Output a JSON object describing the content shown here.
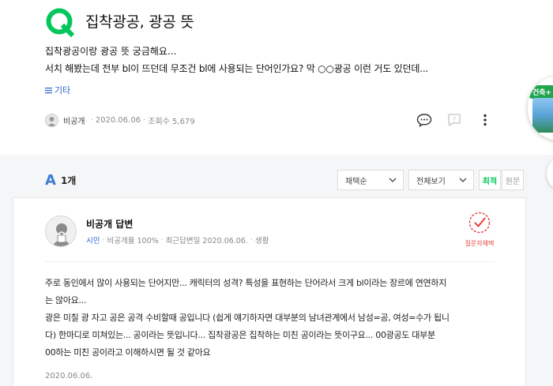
{
  "question": {
    "title": "집착광공, 광공 뜻",
    "body_line1": "집착광공이랑 광공 뜻 궁금해요...",
    "body_line2": "서치 해봤는데 전부 bl이 뜨던데 무조건 bl에 사용되는 단어인가요? 막 ○○광공 이런 거도 있던데...",
    "category": "기타",
    "author": "비공개",
    "date": "2020.06.06",
    "views": "조회수 5,679"
  },
  "side_badge": {
    "tag": "건축+"
  },
  "answers_header": {
    "letter": "A",
    "count": "1개",
    "sort_select": "채택순",
    "view_select": "전체보기",
    "latest": "최적",
    "original": "원문"
  },
  "answer": {
    "name": "비공개 답변",
    "grade": "시민",
    "adoption_rate": "비공개율 100%",
    "last_answer": "최근답변일 2020.06.06.",
    "field": "생활",
    "chosen_label": "질문자채택",
    "lines": [
      "주로 동인에서 많이 사용되는 단어지만... 캐릭터의 성격? 특성을 표현하는 단어라서 크게 bl이라는 장르에 연연하지",
      "는 않아요...",
      "광은 미칠 광 자고 공은 공격 수비할때 공입니다 (쉽게 얘기하자면 대부분의 남녀관계에서 남성=공, 여성=수가 됩니",
      "다) 한마디로 미쳐있는... 공이라는 뜻입니다... 집착광공은 집착하는 미친 공이라는 뜻이구요... 00광공도 대부분",
      "00하는 미친 공이라고 이해하시면 될 것 같아요"
    ],
    "date": "2020.06.06."
  },
  "colors": {
    "brand_green": "#03c75a",
    "link_blue": "#2a63c9",
    "accent_red": "#e2413d"
  }
}
